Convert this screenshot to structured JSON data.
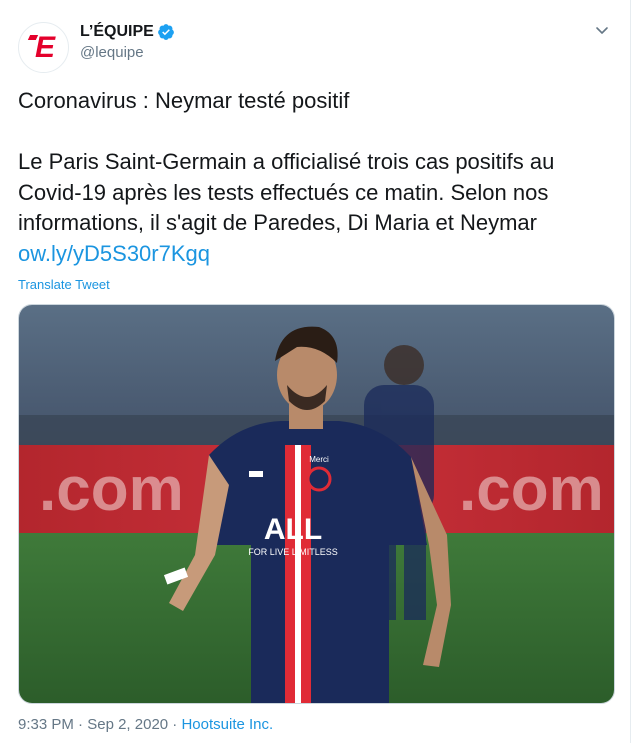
{
  "account": {
    "display_name": "L’ÉQUIPE",
    "handle": "@lequipe",
    "avatar_text": "E",
    "verified": true
  },
  "tweet": {
    "headline": "Coronavirus : Neymar testé positif",
    "body": "Le Paris Saint-Germain a officialisé trois cas positifs au Covid-19 après les tests effectués ce matin. Selon nos informations, il s'agit de Paredes, Di Maria et Neymar ",
    "link": "ow.ly/yD5S30r7Kgq",
    "translate_label": "Translate Tweet"
  },
  "media": {
    "board_text": ".com",
    "sponsor_text": "FOR LIVE LIMITLESS",
    "shirt_text": "ALL",
    "badge_text": "Merci",
    "alt": "Neymar in a PSG shirt walking on the pitch"
  },
  "meta": {
    "time": "9:33 PM",
    "separator": " · ",
    "date": "Sep 2, 2020",
    "source": "Hootsuite Inc."
  },
  "colors": {
    "link": "#1b95e0",
    "secondary_text": "#657786",
    "brand_red": "#e4002b",
    "psg_navy": "#1a2a5a"
  }
}
